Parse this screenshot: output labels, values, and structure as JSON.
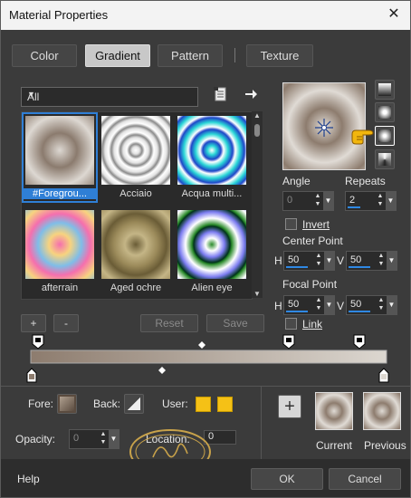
{
  "window": {
    "title": "Material Properties",
    "close_glyph": "✕"
  },
  "tabs": [
    {
      "label": "Color"
    },
    {
      "label": "Gradient",
      "active": true
    },
    {
      "label": "Pattern"
    },
    {
      "label": "Texture"
    }
  ],
  "category": {
    "selected": "All"
  },
  "gradients": [
    {
      "label": "#Foregrou...",
      "selected": true
    },
    {
      "label": "Acciaio"
    },
    {
      "label": "Acqua multi..."
    },
    {
      "label": "afterrain"
    },
    {
      "label": "Aged ochre"
    },
    {
      "label": "Alien eye"
    }
  ],
  "list_buttons": {
    "add": "+",
    "remove": "-",
    "reset": "Reset",
    "save": "Save"
  },
  "angle": {
    "label": "Angle",
    "value": "0"
  },
  "repeats": {
    "label": "Repeats",
    "value": "2"
  },
  "invert": {
    "label": "Invert",
    "checked": false
  },
  "center_point": {
    "label": "Center Point",
    "h_label": "H",
    "h": "50",
    "v_label": "V",
    "v": "50"
  },
  "focal_point": {
    "label": "Focal Point",
    "h_label": "H",
    "h": "50",
    "v_label": "V",
    "v": "50"
  },
  "link": {
    "label": "Link",
    "checked": false
  },
  "materials": {
    "fore_label": "Fore:",
    "back_label": "Back:",
    "user_label": "User:",
    "user_color": "#f5c116"
  },
  "opacity": {
    "label": "Opacity:",
    "value": "0"
  },
  "location": {
    "label": "Location:",
    "value": "0"
  },
  "swatches": {
    "add_glyph": "+",
    "current_label": "Current",
    "previous_label": "Previous"
  },
  "footer": {
    "help": "Help",
    "ok": "OK",
    "cancel": "Cancel"
  },
  "colors": {
    "accent": "#2f7fd6",
    "gradient_start": "#8d7c6e",
    "gradient_end": "#dcd7d0",
    "pointer_hand": "#f2b60d"
  }
}
